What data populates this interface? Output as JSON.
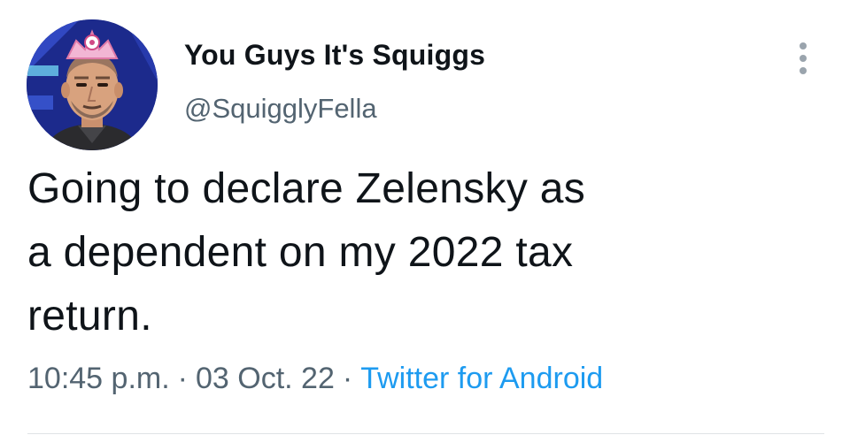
{
  "author": {
    "display_name": "You Guys It's Squiggs",
    "handle": "@SquigglyFella"
  },
  "tweet": {
    "lines": [
      "Going to declare Zelensky as",
      "a dependent on my 2022 tax",
      "return."
    ]
  },
  "meta": {
    "time": "10:45 p.m.",
    "separator": "·",
    "date": "03 Oct. 22",
    "source": "Twitter for Android"
  },
  "icons": {
    "more": "more-vertical-icon"
  },
  "colors": {
    "text": "#0f1419",
    "secondary": "#536471",
    "link": "#1d9bf0",
    "divider": "#dfe3e6"
  }
}
